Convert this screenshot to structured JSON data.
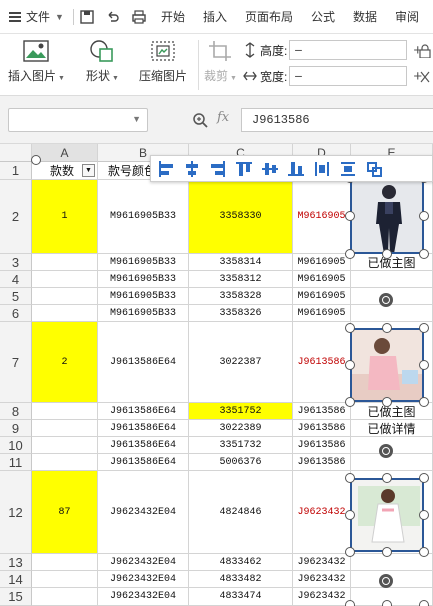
{
  "menubar": {
    "file": "文件",
    "tabs": [
      "开始",
      "插入",
      "页面布局",
      "公式",
      "数据",
      "审阅"
    ]
  },
  "ribbon": {
    "insert_picture": "插入图片",
    "shape": "形状",
    "compress_picture": "压缩图片",
    "crop": "裁剪",
    "height_label": "高度:",
    "width_label": "宽度:",
    "height_value": "",
    "width_value": ""
  },
  "formula_bar": {
    "name_box": "",
    "fx": "fx",
    "formula": "J9613586"
  },
  "columns": [
    "A",
    "B",
    "C",
    "D",
    "E"
  ],
  "header_row": {
    "a": "款数",
    "b": "款号颜色",
    "c": "",
    "d": "",
    "e": ""
  },
  "rows": [
    {
      "num": "2",
      "a": "1",
      "b": "M9616905B33",
      "c": "3358330",
      "d": "M9616905",
      "e": ""
    },
    {
      "num": "3",
      "a": "",
      "b": "M9616905B33",
      "c": "3358314",
      "d": "M9616905",
      "e": "已做主图"
    },
    {
      "num": "4",
      "a": "",
      "b": "M9616905B33",
      "c": "3358312",
      "d": "M9616905",
      "e": ""
    },
    {
      "num": "5",
      "a": "",
      "b": "M9616905B33",
      "c": "3358328",
      "d": "M9616905",
      "e": ""
    },
    {
      "num": "6",
      "a": "",
      "b": "M9616905B33",
      "c": "3358326",
      "d": "M9616905",
      "e": ""
    },
    {
      "num": "7",
      "a": "2",
      "b": "J9613586E64",
      "c": "3022387",
      "d": "J9613586",
      "e": ""
    },
    {
      "num": "8",
      "a": "",
      "b": "J9613586E64",
      "c": "3351752",
      "d": "J9613586",
      "e": "已做主图"
    },
    {
      "num": "9",
      "a": "",
      "b": "J9613586E64",
      "c": "3022389",
      "d": "J9613586",
      "e": "已做详情"
    },
    {
      "num": "10",
      "a": "",
      "b": "J9613586E64",
      "c": "3351732",
      "d": "J9613586",
      "e": ""
    },
    {
      "num": "11",
      "a": "",
      "b": "J9613586E64",
      "c": "5006376",
      "d": "J9613586",
      "e": ""
    },
    {
      "num": "12",
      "a": "87",
      "b": "J9623432E04",
      "c": "4824846",
      "d": "J9623432",
      "e": ""
    },
    {
      "num": "13",
      "a": "",
      "b": "J9623432E04",
      "c": "4833462",
      "d": "J9623432",
      "e": ""
    },
    {
      "num": "14",
      "a": "",
      "b": "J9623432E04",
      "c": "4833482",
      "d": "J9623432",
      "e": ""
    },
    {
      "num": "15",
      "a": "",
      "b": "J9623432E04",
      "c": "4833474",
      "d": "J9623432",
      "e": ""
    }
  ],
  "colors": {
    "highlight": "#ffff00",
    "red_text": "#c00000",
    "selection": "#2b5797",
    "accent": "#2b6cc4"
  }
}
